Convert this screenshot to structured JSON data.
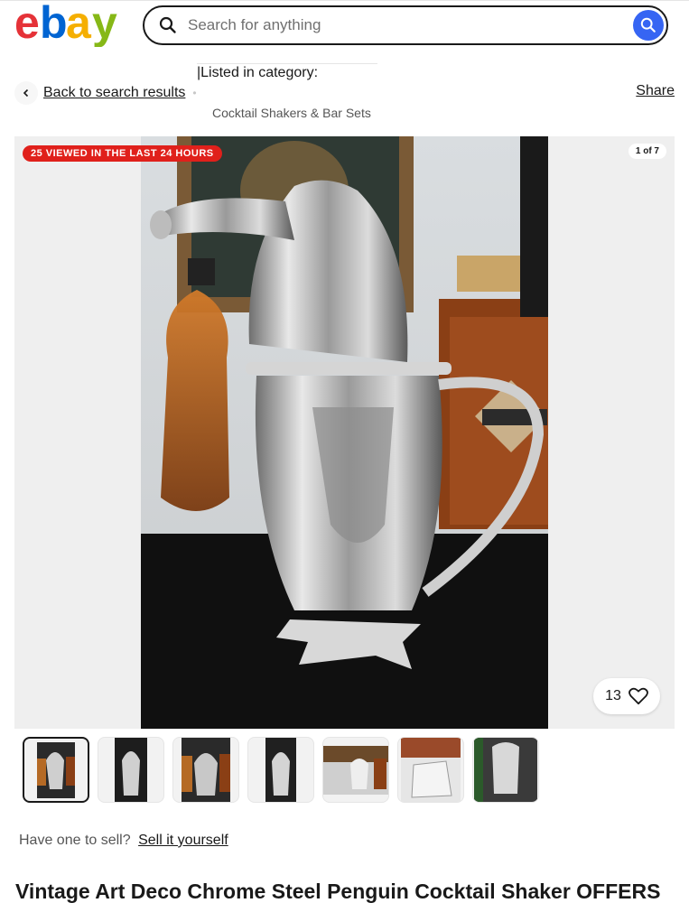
{
  "header": {
    "logo_letters": [
      "e",
      "b",
      "a",
      "y"
    ],
    "logo_colors": [
      "#e53238",
      "#0064d2",
      "#f5af02",
      "#86b817"
    ],
    "search_placeholder": "Search for anything",
    "search_icon": "search-icon"
  },
  "breadcrumb": {
    "back_label": "Back to search results",
    "listed_label": "|Listed in category:",
    "category": "Cocktail Shakers & Bar Sets",
    "share_label": "Share"
  },
  "gallery": {
    "badge": "25 VIEWED IN THE LAST 24 HOURS",
    "counter": "1 of 7",
    "watch_count": "13",
    "badge_color": "#e0201b"
  },
  "thumbnails": [
    {
      "name": "thumbnail-1",
      "active": true
    },
    {
      "name": "thumbnail-2",
      "active": false
    },
    {
      "name": "thumbnail-3",
      "active": false
    },
    {
      "name": "thumbnail-4",
      "active": false
    },
    {
      "name": "thumbnail-5",
      "active": false
    },
    {
      "name": "thumbnail-6",
      "active": false
    },
    {
      "name": "thumbnail-7",
      "active": false
    }
  ],
  "sell": {
    "prompt": "Have one to sell?",
    "link": "Sell it yourself"
  },
  "listing": {
    "title": "Vintage Art Deco Chrome Steel Penguin Cocktail Shaker OFFERS"
  },
  "accent_color": "#3665f3"
}
